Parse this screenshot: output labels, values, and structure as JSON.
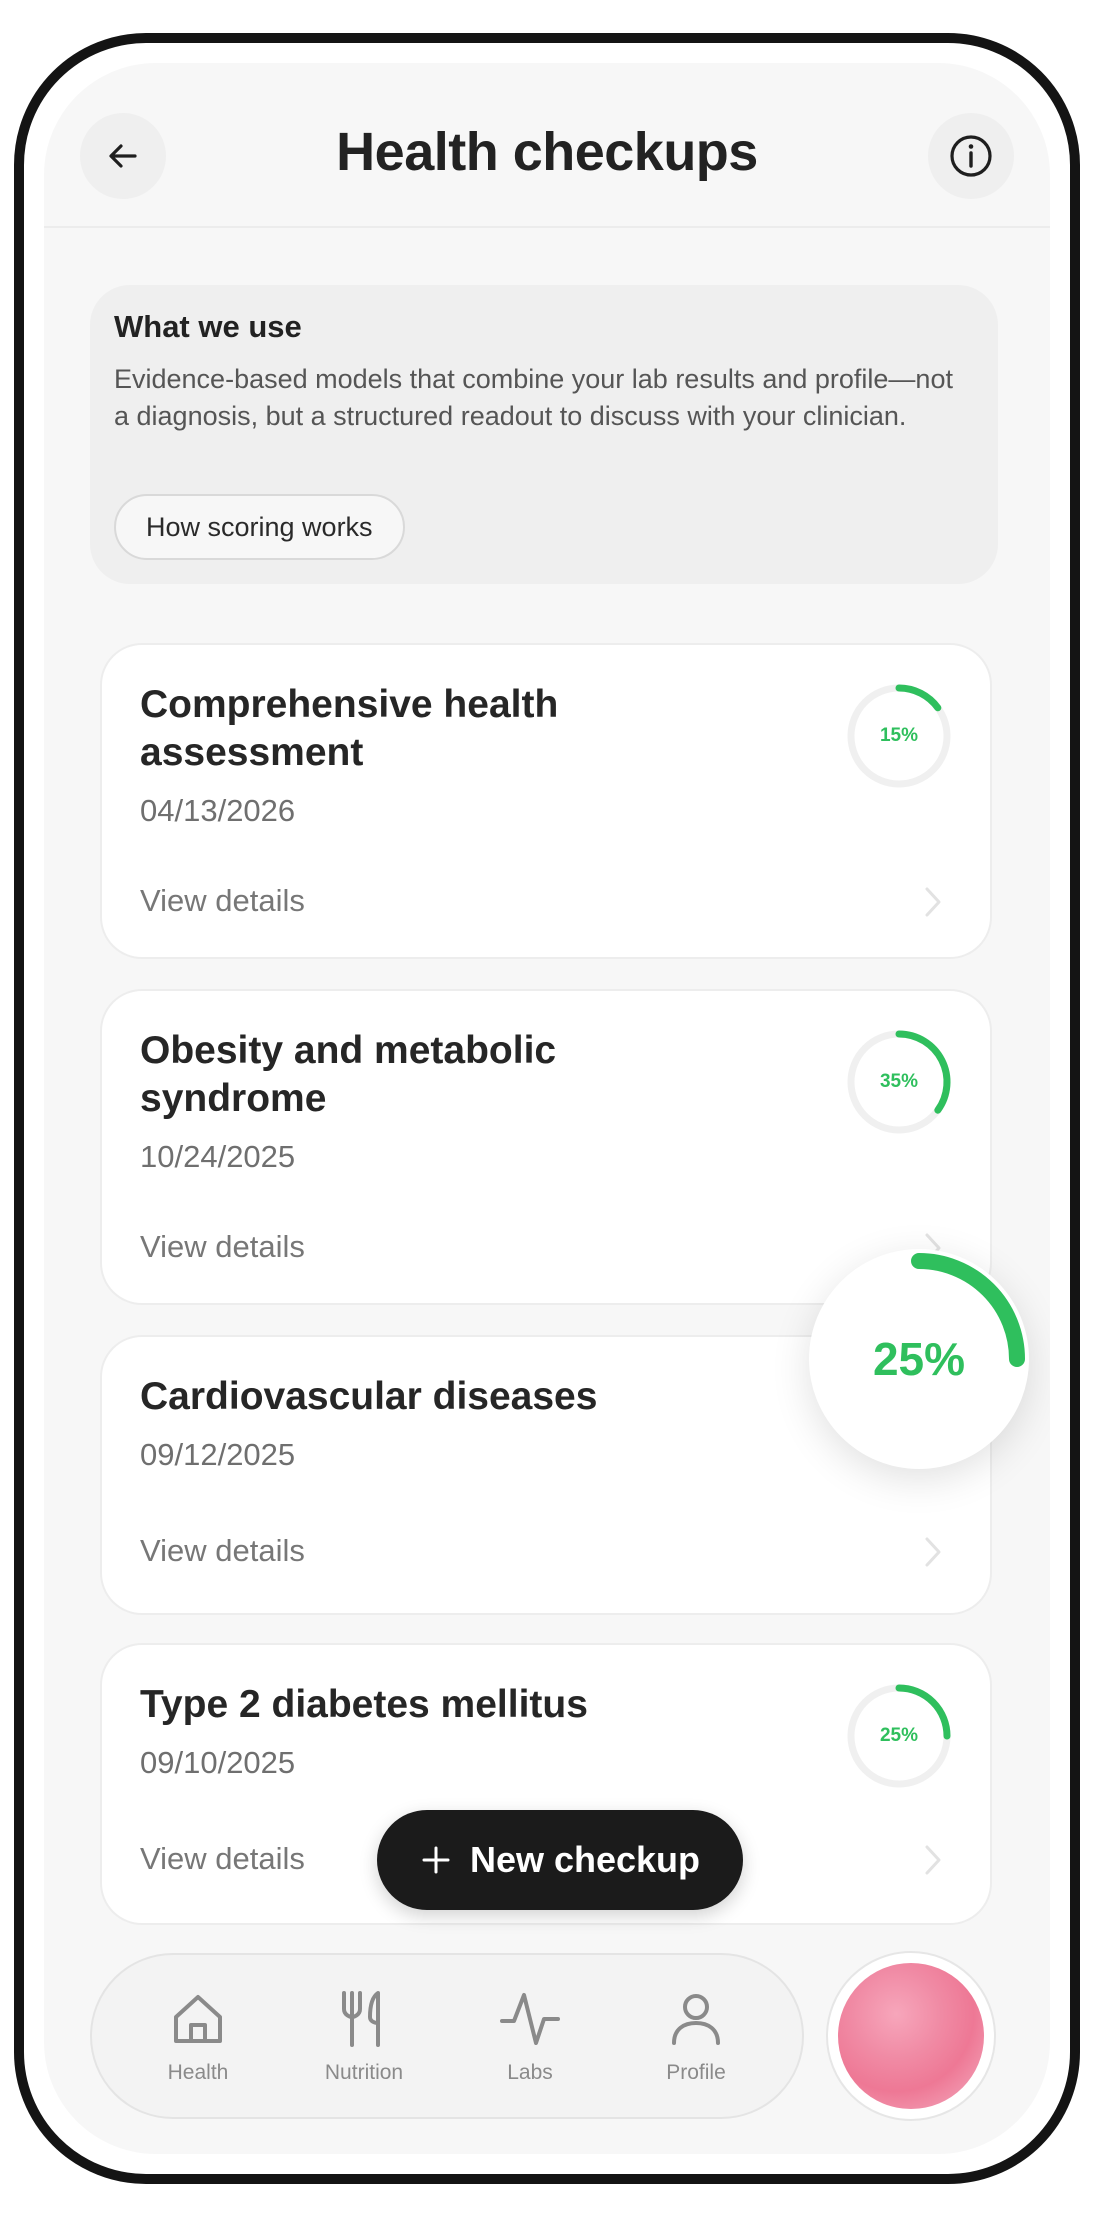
{
  "header": {
    "title": "Health checkups",
    "back_icon": "arrow-left-icon",
    "info_icon": "info-icon"
  },
  "info_panel": {
    "heading": "What we use",
    "body": "Evidence-based models that combine your lab results and profile—not a diagnosis, but a structured readout to discuss with your clinician.",
    "button_label": "How scoring works"
  },
  "checkups": [
    {
      "title": "Comprehensive health assessment",
      "date": "04/13/2026",
      "link_label": "View details",
      "score_label": "15%",
      "score": 0.15
    },
    {
      "title": "Obesity and metabolic syndrome",
      "date": "10/24/2025",
      "link_label": "View details",
      "score_label": "35%",
      "score": 0.35
    },
    {
      "title": "Cardiovascular diseases",
      "date": "09/12/2025",
      "link_label": "View details",
      "score_label": "25%",
      "score": 0.25
    },
    {
      "title": "Type 2 diabetes mellitus",
      "date": "09/10/2025",
      "link_label": "View details",
      "score_label": "25%",
      "score": 0.25
    }
  ],
  "floating_score": {
    "label": "25%",
    "value": 0.25
  },
  "new_checkup": {
    "label": "New checkup",
    "icon": "plus-icon"
  },
  "nav": {
    "items": [
      {
        "label": "Health",
        "icon": "home-icon"
      },
      {
        "label": "Nutrition",
        "icon": "fork-knife-icon"
      },
      {
        "label": "Labs",
        "icon": "pulse-icon"
      },
      {
        "label": "Profile",
        "icon": "person-icon"
      }
    ]
  },
  "colors": {
    "accent_green": "#2fbf5d",
    "ring_track": "#f0f0f0",
    "dark_button": "#1b1b1b",
    "background": "#f7f7f7"
  }
}
